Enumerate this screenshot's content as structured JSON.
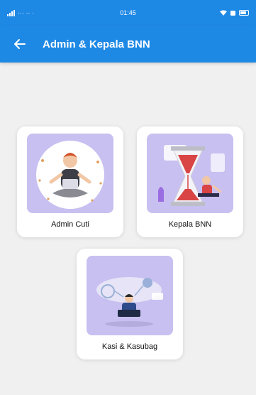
{
  "status_bar": {
    "left_text": "··· ·· ·",
    "time": "01:45"
  },
  "header": {
    "title": "Admin & Kepala BNN",
    "back_icon": "arrow-left-icon"
  },
  "colors": {
    "primary": "#1e88e5",
    "card_art_bg": "#c8c0f0",
    "background": "#f0f0f0"
  },
  "menu": [
    {
      "label": "Admin Cuti",
      "icon": "meditating-person-illustration"
    },
    {
      "label": "Kepala BNN",
      "icon": "hourglass-person-illustration"
    },
    {
      "label": "Kasi & Kasubag",
      "icon": "person-computer-cloud-illustration"
    }
  ]
}
